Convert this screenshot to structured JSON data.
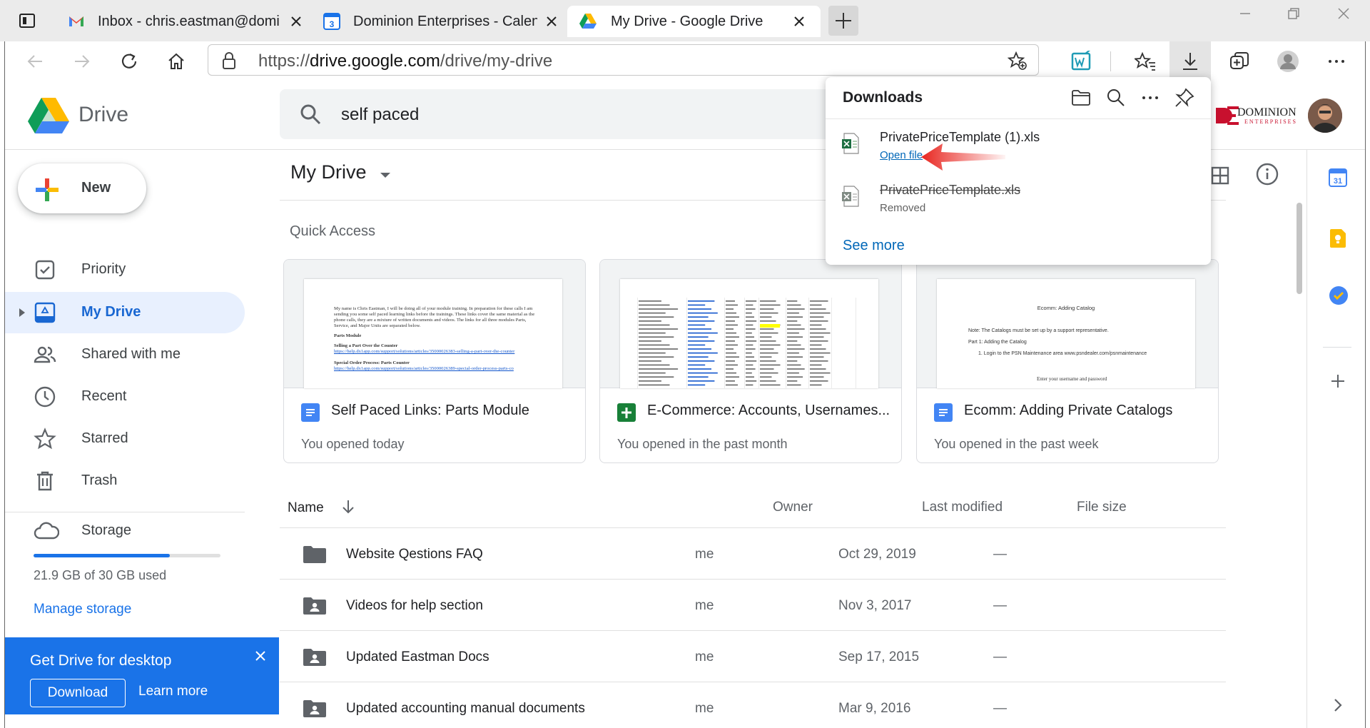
{
  "browser": {
    "tabs": [
      {
        "title": "Inbox - chris.eastman@dominion"
      },
      {
        "title": "Dominion Enterprises - Calendar"
      },
      {
        "title": "My Drive - Google Drive"
      }
    ],
    "url_prefix": "https://",
    "url_domain": "drive.google.com",
    "url_path": "/drive/my-drive"
  },
  "app": {
    "name": "Drive",
    "search_value": "self paced",
    "brand_text": "DOMINION",
    "brand_sub": "ENTERPRISES"
  },
  "sidebar": {
    "new_label": "New",
    "items": [
      {
        "label": "Priority",
        "icon": "priority-icon"
      },
      {
        "label": "My Drive",
        "icon": "my-drive-icon"
      },
      {
        "label": "Shared with me",
        "icon": "people-icon"
      },
      {
        "label": "Recent",
        "icon": "clock-icon"
      },
      {
        "label": "Starred",
        "icon": "star-icon"
      },
      {
        "label": "Trash",
        "icon": "trash-icon"
      }
    ],
    "storage_label": "Storage",
    "storage_used_text": "21.9 GB of 30 GB used",
    "storage_fraction": 0.73,
    "manage_storage": "Manage storage",
    "promo": {
      "title": "Get Drive for desktop",
      "download": "Download",
      "learn_more": "Learn more"
    }
  },
  "main": {
    "title": "My Drive",
    "quick_access_label": "Quick Access",
    "quick_access": [
      {
        "name": "Self Paced Links: Parts Module",
        "sub": "You opened today",
        "type": "doc"
      },
      {
        "name": "E-Commerce: Accounts, Usernames...",
        "sub": "You opened in the past month",
        "type": "sheet"
      },
      {
        "name": "Ecomm: Adding Private Catalogs",
        "sub": "You opened in the past week",
        "type": "doc"
      }
    ],
    "thumb_texts": {
      "doc1_para": "My name is Chris Eastman, I will be doing all of your module training. In preparation for these calls I am sending you some self paced learning links before the trainings. These links cover the same material as the phone calls, they are a mixture of written documents and videos. The links for all three modules Parts, Service, and Major Units are separated below.",
      "doc1_h1": "Parts Module",
      "doc1_h2": "Selling a Part Over the Counter",
      "doc1_l1": "https://help.dx1app.com/support/solutions/articles/35000026383-selling-a-part-over-the-counter",
      "doc1_h3": "Special Order Process: Parts Counter",
      "doc1_l2": "https://help.dx1app.com/support/solutions/articles/35000026389-special-order-process-parts-co",
      "doc3_title": "Ecomm: Adding Catalog",
      "doc3_note": "Note: The Catalogs must be set up by a support representative.",
      "doc3_part": "Part 1: Adding the Catalog",
      "doc3_step": "1.   Login to the PSN Maintenance area www.psndealer.com/psnmaintenance",
      "doc3_enter": "Enter your username and password"
    },
    "columns": {
      "name": "Name",
      "owner": "Owner",
      "modified": "Last modified",
      "size": "File size"
    },
    "rows": [
      {
        "name": "Website Qestions FAQ",
        "owner": "me",
        "modified": "Oct 29, 2019",
        "size": "—",
        "shared": false
      },
      {
        "name": "Videos for help section",
        "owner": "me",
        "modified": "Nov 3, 2017",
        "size": "—",
        "shared": true
      },
      {
        "name": "Updated Eastman Docs",
        "owner": "me",
        "modified": "Sep 17, 2015",
        "size": "—",
        "shared": true
      },
      {
        "name": "Updated accounting manual documents",
        "owner": "me",
        "modified": "Mar 9, 2016",
        "size": "—",
        "shared": true
      }
    ]
  },
  "downloads": {
    "title": "Downloads",
    "items": [
      {
        "filename": "PrivatePriceTemplate (1).xls",
        "status": "Open file",
        "removed": false
      },
      {
        "filename": "PrivatePriceTemplate.xls",
        "status": "Removed",
        "removed": true
      }
    ],
    "see_more": "See more"
  },
  "colors": {
    "accent": "#1a73e8",
    "selected_bg": "#e8f0fe",
    "arrow_red": "#e8251f",
    "sheet_green": "#188038",
    "doc_blue": "#4285f4"
  }
}
